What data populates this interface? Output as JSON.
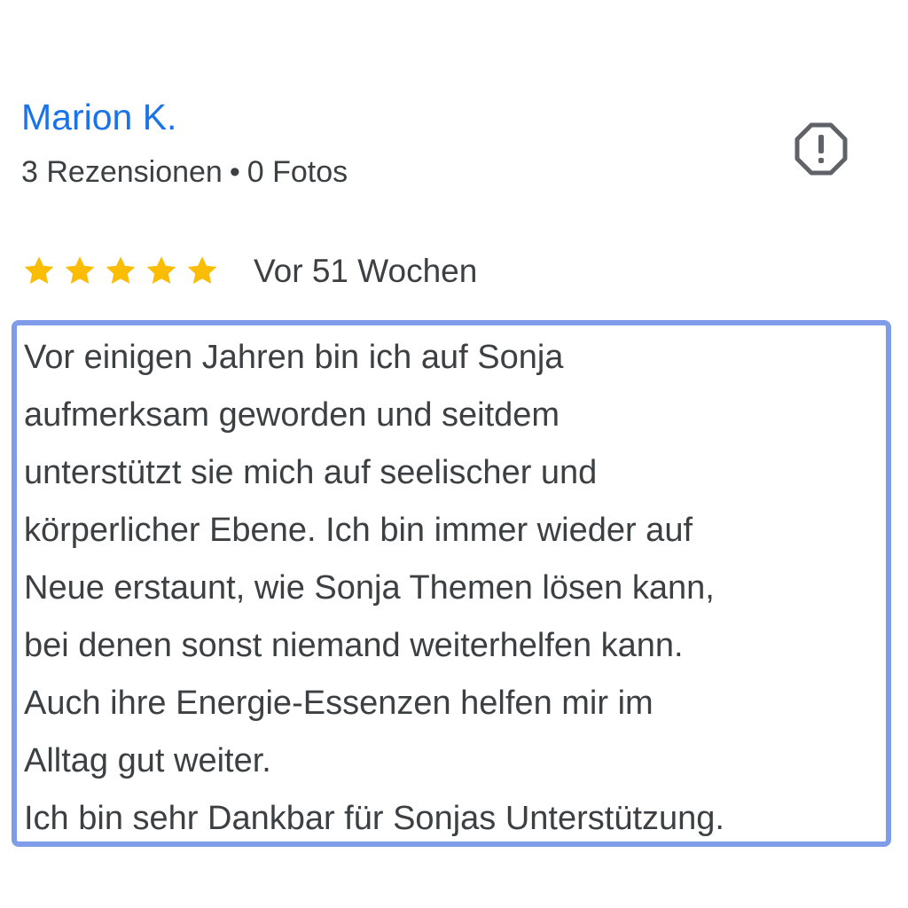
{
  "reviewer": {
    "name": "Marion K.",
    "reviews_count_text": "3 Rezensionen",
    "separator": "•",
    "photos_count_text": "0 Fotos"
  },
  "actions": {
    "report_icon": "report-octagon-icon",
    "icon_color": "#5f6368"
  },
  "rating": {
    "stars": 5,
    "max_stars": 5,
    "star_color": "#fbbc04",
    "date": "Vor 51 Wochen"
  },
  "review": {
    "lines": [
      "Vor einigen Jahren bin ich auf Sonja",
      "aufmerksam geworden und seitdem",
      "unterstützt sie mich auf seelischer und",
      "körperlicher Ebene. Ich bin immer wieder auf",
      "Neue erstaunt, wie Sonja Themen lösen kann,",
      "bei denen sonst niemand weiterhelfen kann.",
      "Auch ihre Energie-Essenzen helfen mir im",
      "Alltag gut weiter.",
      "Ich bin sehr Dankbar für Sonjas Unterstützung."
    ],
    "highlight_color": "#7e9ce8"
  },
  "colors": {
    "name": "#1a73e8",
    "text": "#3c4043"
  }
}
